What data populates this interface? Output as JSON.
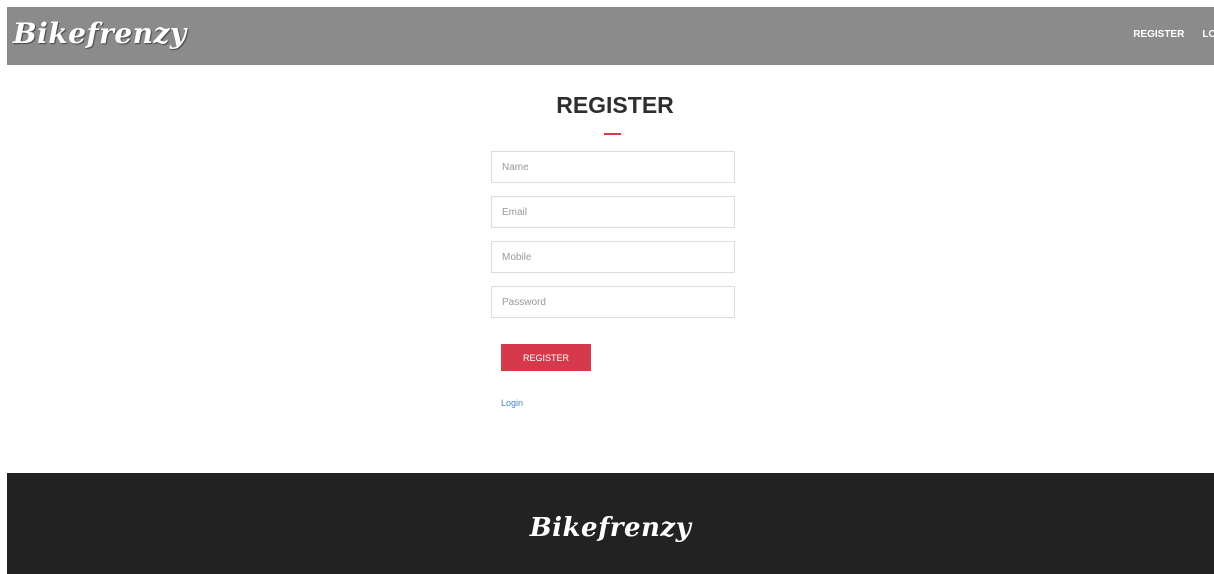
{
  "header": {
    "brand": "Bikefrenzy",
    "nav": [
      {
        "label": "REGISTER"
      },
      {
        "label": "LOGIN"
      }
    ]
  },
  "form": {
    "title": "REGISTER",
    "fields": {
      "name": {
        "placeholder": "Name",
        "value": ""
      },
      "email": {
        "placeholder": "Email",
        "value": ""
      },
      "mobile": {
        "placeholder": "Mobile",
        "value": ""
      },
      "password": {
        "placeholder": "Password",
        "value": ""
      }
    },
    "submit_label": "REGISTER",
    "login_link": "Login"
  },
  "footer": {
    "brand": "Bikefrenzy"
  },
  "colors": {
    "navbar_bg": "#8b8b8b",
    "accent": "#d7394c",
    "link": "#4a86c5",
    "footer_bg": "#222222"
  }
}
